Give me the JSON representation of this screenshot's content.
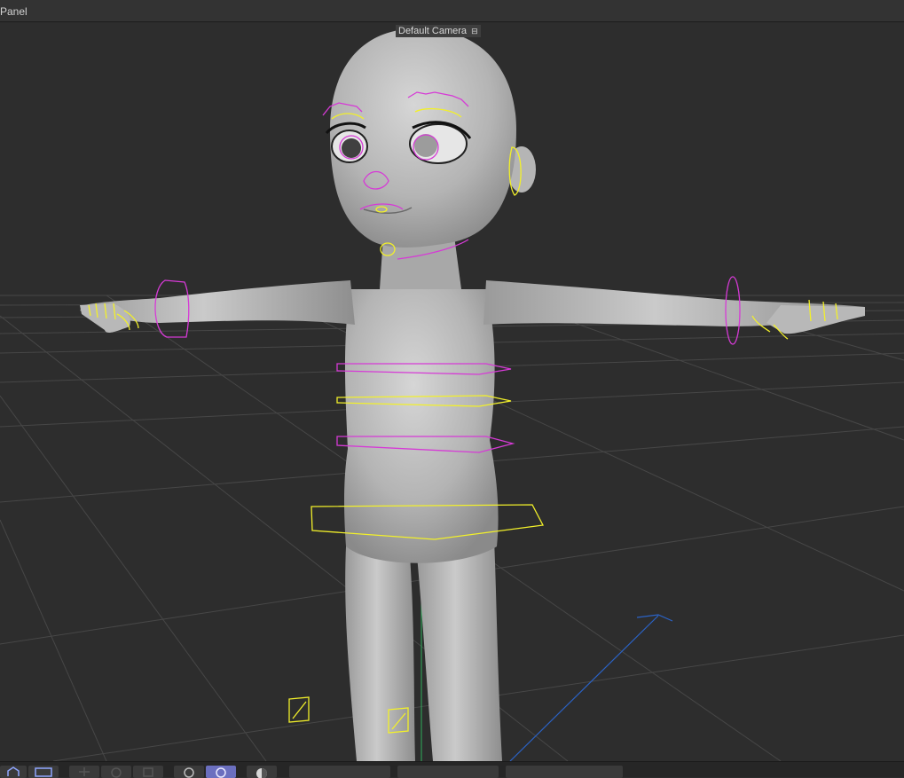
{
  "panel": {
    "title": "Panel"
  },
  "viewport": {
    "camera_label": "Default Camera",
    "camera_icon": "camera-lock-icon"
  },
  "colors": {
    "background": "#2d2d2d",
    "grid": "#4a4a4a",
    "mesh": "#a9a9a9",
    "control_yellow": "#f2f02a",
    "control_magenta": "#d63ad6",
    "axis_y": "#2fae5c",
    "axis_z": "#2b63c7",
    "toolbar_active": "#6b6fbf"
  },
  "toolbar": {
    "buttons": [
      {
        "icon": "home-icon"
      },
      {
        "icon": "frame-selection-icon"
      },
      {
        "icon": "move-icon"
      },
      {
        "icon": "rotate-icon"
      },
      {
        "icon": "scale-icon"
      },
      {
        "icon": "snap-icon"
      },
      {
        "icon": "active-snap-icon"
      },
      {
        "icon": "shading-icon"
      }
    ]
  }
}
